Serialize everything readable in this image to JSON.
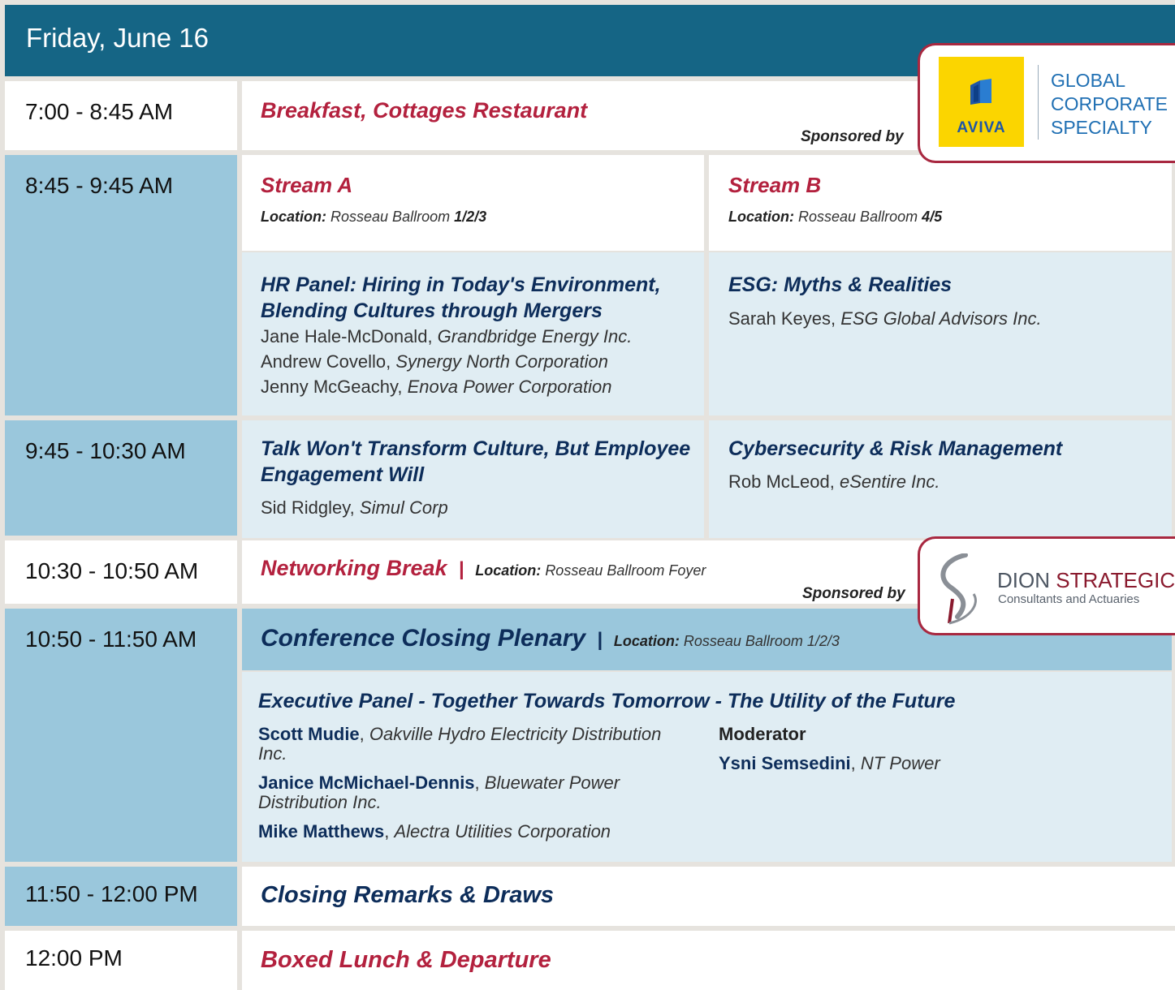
{
  "header": {
    "date": "Friday, June 16"
  },
  "rows": {
    "r1": {
      "time": "7:00 - 8:45 AM",
      "title": "Breakfast, Cottages Restaurant",
      "sponsored_by": "Sponsored by"
    },
    "r2": {
      "time": "8:45 - 9:45 AM",
      "stream_a": {
        "title": "Stream A",
        "loc_label": "Location:",
        "loc_venue": "Rosseau Ballroom",
        "loc_rooms": "1/2/3"
      },
      "stream_b": {
        "title": "Stream B",
        "loc_label": "Location:",
        "loc_venue": "Rosseau Ballroom",
        "loc_rooms": "4/5"
      },
      "session_a": {
        "title": "HR Panel: Hiring in Today's Environment, Blending Cultures through Mergers",
        "people": [
          {
            "name": "Jane Hale-McDonald",
            "org": "Grandbridge Energy Inc."
          },
          {
            "name": "Andrew Covello",
            "org": "Synergy North Corporation"
          },
          {
            "name": "Jenny McGeachy",
            "org": "Enova Power Corporation"
          }
        ]
      },
      "session_b": {
        "title": "ESG: Myths & Realities",
        "people": [
          {
            "name": "Sarah Keyes",
            "org": "ESG Global Advisors Inc."
          }
        ]
      }
    },
    "r3": {
      "time": "9:45 - 10:30 AM",
      "session_a": {
        "title": "Talk Won't Transform Culture, But Employee Engagement Will",
        "people": [
          {
            "name": "Sid Ridgley",
            "org": "Simul Corp"
          }
        ]
      },
      "session_b": {
        "title": "Cybersecurity & Risk Management",
        "people": [
          {
            "name": "Rob McLeod",
            "org": "eSentire Inc."
          }
        ]
      }
    },
    "r4": {
      "time": "10:30 - 10:50 AM",
      "title": "Networking Break",
      "sep": "|",
      "loc_label": "Location:",
      "loc_venue": "Rosseau Ballroom Foyer",
      "sponsored_by": "Sponsored by"
    },
    "r5": {
      "time": "10:50 - 11:50 AM",
      "title": "Conference Closing Plenary",
      "sep": "|",
      "loc_label": "Location:",
      "loc_venue": "Rosseau Ballroom 1/2/3",
      "panel_title": "Executive Panel - Together Towards Tomorrow - The Utility of the Future",
      "panelists": [
        {
          "name": "Scott Mudie",
          "org": "Oakville Hydro Electricity Distribution Inc."
        },
        {
          "name": "Janice McMichael-Dennis",
          "org": "Bluewater Power Distribution Inc."
        },
        {
          "name": "Mike Matthews",
          "org": "Alectra Utilities Corporation"
        }
      ],
      "moderator_label": "Moderator",
      "moderator": {
        "name": "Ysni Semsedini",
        "org": "NT Power"
      }
    },
    "r6": {
      "time": "11:50 - 12:00 PM",
      "title": "Closing Remarks & Draws"
    },
    "r7": {
      "time": "12:00 PM",
      "title": "Boxed Lunch & Departure"
    }
  },
  "sponsors": {
    "aviva": {
      "logo_text": "AVIVA",
      "line1": "GLOBAL",
      "line2": "CORPORATE",
      "line3": "SPECIALTY"
    },
    "dion": {
      "name_a": "DION",
      "name_b": "STRATEGIC",
      "tagline": "Consultants and Actuaries"
    }
  },
  "colors": {
    "header": "#156585",
    "red": "#b3213e",
    "navy": "#0d2d5a",
    "blue": "#9ac7dc",
    "light": "#e0edf3",
    "sponsor_border": "#a82840"
  }
}
